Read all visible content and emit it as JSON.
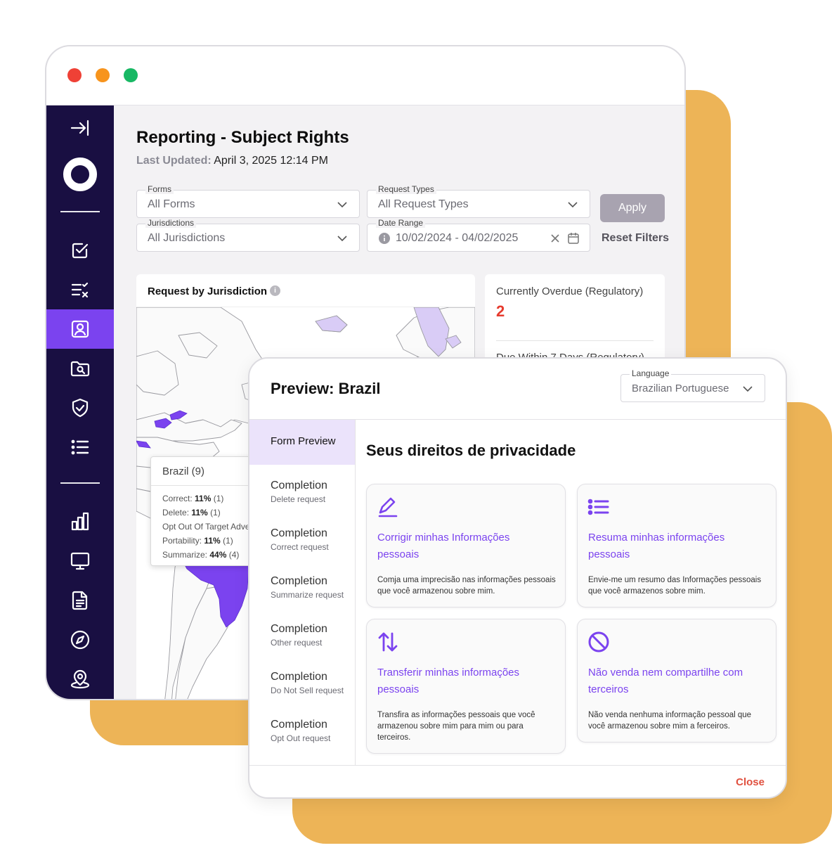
{
  "page": {
    "title": "Reporting - Subject Rights",
    "updated_label": "Last Updated:",
    "updated_value": "April 3, 2025 12:14 PM"
  },
  "filters": {
    "forms_label": "Forms",
    "forms_value": "All Forms",
    "request_types_label": "Request Types",
    "request_types_value": "All Request Types",
    "jurisdictions_label": "Jurisdictions",
    "jurisdictions_value": "All Jurisdictions",
    "date_range_label": "Date Range",
    "date_range_value": "10/02/2024 - 04/02/2025",
    "apply_label": "Apply",
    "reset_label": "Reset Filters"
  },
  "map_card": {
    "title": "Request by Jurisdiction",
    "info": "i",
    "tooltip": {
      "title": "Brazil (9)",
      "rows": [
        {
          "label": "Correct:",
          "pct": "11%",
          "count": "(1)"
        },
        {
          "label": "Delete:",
          "pct": "11%",
          "count": "(1)"
        },
        {
          "label": "Opt Out Of Target Adve",
          "pct": "",
          "count": ""
        },
        {
          "label": "Portability:",
          "pct": "11%",
          "count": "(1)"
        },
        {
          "label": "Summarize:",
          "pct": "44%",
          "count": "(4)"
        }
      ]
    }
  },
  "stats": {
    "overdue_label": "Currently Overdue (Regulatory)",
    "overdue_value": "2",
    "due_label": "Due Within 7 Days (Regulatory)"
  },
  "sidebar": {
    "icons": [
      "collapse-icon",
      "logo",
      "checklist-icon",
      "task-list-icon",
      "user-profile-icon",
      "folder-search-icon",
      "shield-check-icon",
      "list-icon",
      "bar-chart-icon",
      "monitor-icon",
      "document-icon",
      "compass-icon",
      "location-user-icon"
    ],
    "active": "user-profile-icon"
  },
  "modal": {
    "title": "Preview: Brazil",
    "language_label": "Language",
    "language_value": "Brazilian Portuguese",
    "nav": [
      {
        "title": "Form Preview",
        "sub": ""
      },
      {
        "title": "Completion",
        "sub": "Delete request"
      },
      {
        "title": "Completion",
        "sub": "Correct request"
      },
      {
        "title": "Completion",
        "sub": "Summarize request"
      },
      {
        "title": "Completion",
        "sub": "Other request"
      },
      {
        "title": "Completion",
        "sub": "Do Not Sell request"
      },
      {
        "title": "Completion",
        "sub": "Opt Out request"
      }
    ],
    "heading": "Seus direitos de privacidade",
    "cards": [
      {
        "icon": "pencil-icon",
        "title": "Corrigir minhas Informações pessoais",
        "desc": "Comja uma imprecisão nas informações pessoais que você armazenou sobre mim."
      },
      {
        "icon": "list-icon",
        "title": "Resuma minhas informações pessoais",
        "desc": "Envie-me um resumo das Informações pessoais que você armazenos sobre mim."
      },
      {
        "icon": "transfer-arrows-icon",
        "title": "Transferir minhas informações pessoais",
        "desc": "Transfira as informações pessoais que você armazenou sobre mim para mim ou para terceiros."
      },
      {
        "icon": "prohibited-icon",
        "title": "Não venda nem compartilhe com terceiros",
        "desc": "Não venda nenhuma informação pessoal que você armazenou sobre mim a ferceiros."
      }
    ],
    "close_label": "Close"
  },
  "colors": {
    "accent": "#7b43ef",
    "sidebar": "#190f42",
    "orange_bg": "#edb457",
    "overdue": "#e63b2e",
    "close": "#e0503f"
  }
}
